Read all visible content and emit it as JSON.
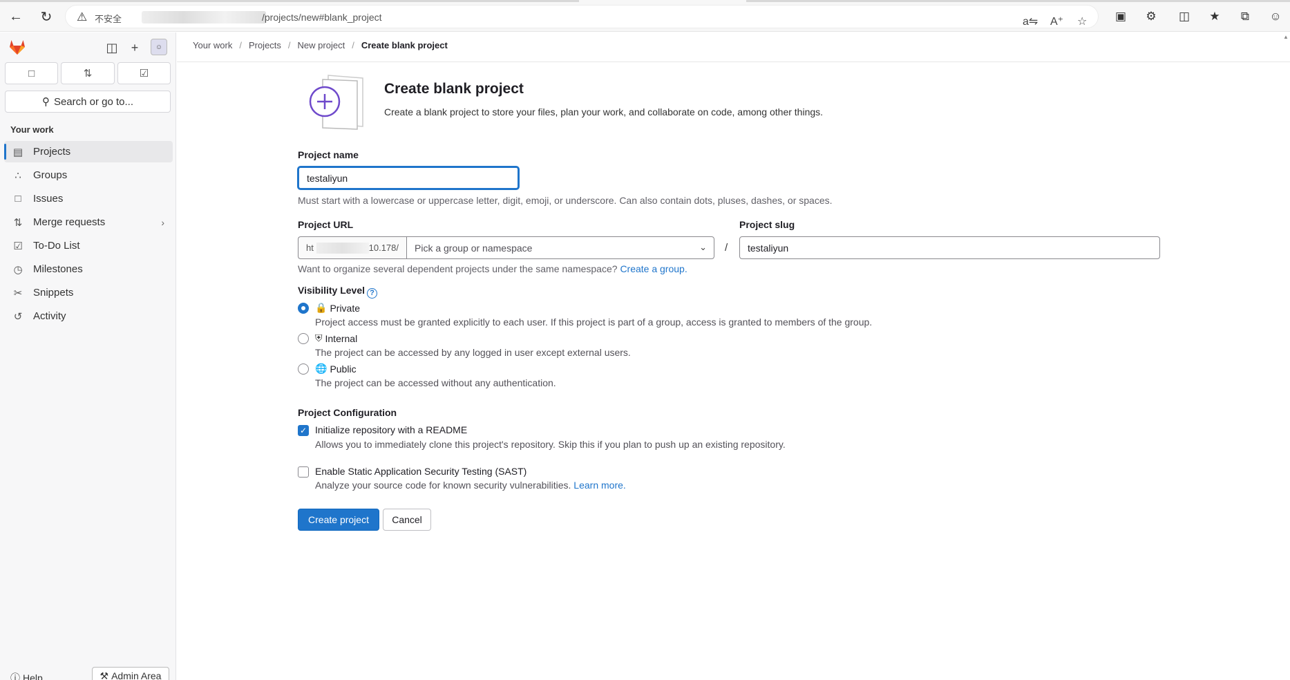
{
  "browser": {
    "insecure_label": "不安全",
    "url_path": "/projects/new#blank_project"
  },
  "sidebar": {
    "section_title": "Your work",
    "search_label": "Search or go to...",
    "items": [
      {
        "label": "Projects",
        "icon": "project-icon"
      },
      {
        "label": "Groups",
        "icon": "group-icon"
      },
      {
        "label": "Issues",
        "icon": "issues-icon"
      },
      {
        "label": "Merge requests",
        "icon": "merge-request-icon"
      },
      {
        "label": "To-Do List",
        "icon": "todo-icon"
      },
      {
        "label": "Milestones",
        "icon": "milestone-icon"
      },
      {
        "label": "Snippets",
        "icon": "snippet-icon"
      },
      {
        "label": "Activity",
        "icon": "history-icon"
      }
    ],
    "help_label": "Help",
    "admin_label": "Admin Area"
  },
  "breadcrumb": [
    "Your work",
    "Projects",
    "New project",
    "Create blank project"
  ],
  "page": {
    "title": "Create blank project",
    "intro": "Create a blank project to store your files, plan your work, and collaborate on code, among other things.",
    "project_name_label": "Project name",
    "project_name_value": "testaliyun",
    "project_name_help": "Must start with a lowercase or uppercase letter, digit, emoji, or underscore. Can also contain dots, pluses, dashes, or spaces.",
    "project_url_label": "Project URL",
    "url_prefix": "ht",
    "url_prefix_tail": "10.178/",
    "namespace_placeholder": "Pick a group or namespace",
    "project_slug_label": "Project slug",
    "project_slug_value": "testaliyun",
    "namespace_help": "Want to organize several dependent projects under the same namespace?",
    "create_group_link": "Create a group.",
    "visibility_label": "Visibility Level",
    "visibility": [
      {
        "label": "Private",
        "desc": "Project access must be granted explicitly to each user. If this project is part of a group, access is granted to members of the group.",
        "selected": true
      },
      {
        "label": "Internal",
        "desc": "The project can be accessed by any logged in user except external users.",
        "selected": false
      },
      {
        "label": "Public",
        "desc": "The project can be accessed without any authentication.",
        "selected": false
      }
    ],
    "config_label": "Project Configuration",
    "readme_label": "Initialize repository with a README",
    "readme_desc": "Allows you to immediately clone this project's repository. Skip this if you plan to push up an existing repository.",
    "sast_label": "Enable Static Application Security Testing (SAST)",
    "sast_desc": "Analyze your source code for known security vulnerabilities.",
    "learn_more": "Learn more.",
    "create_button": "Create project",
    "cancel_button": "Cancel"
  },
  "colors": {
    "accent": "#1f75cb",
    "brand": "#e24329"
  }
}
